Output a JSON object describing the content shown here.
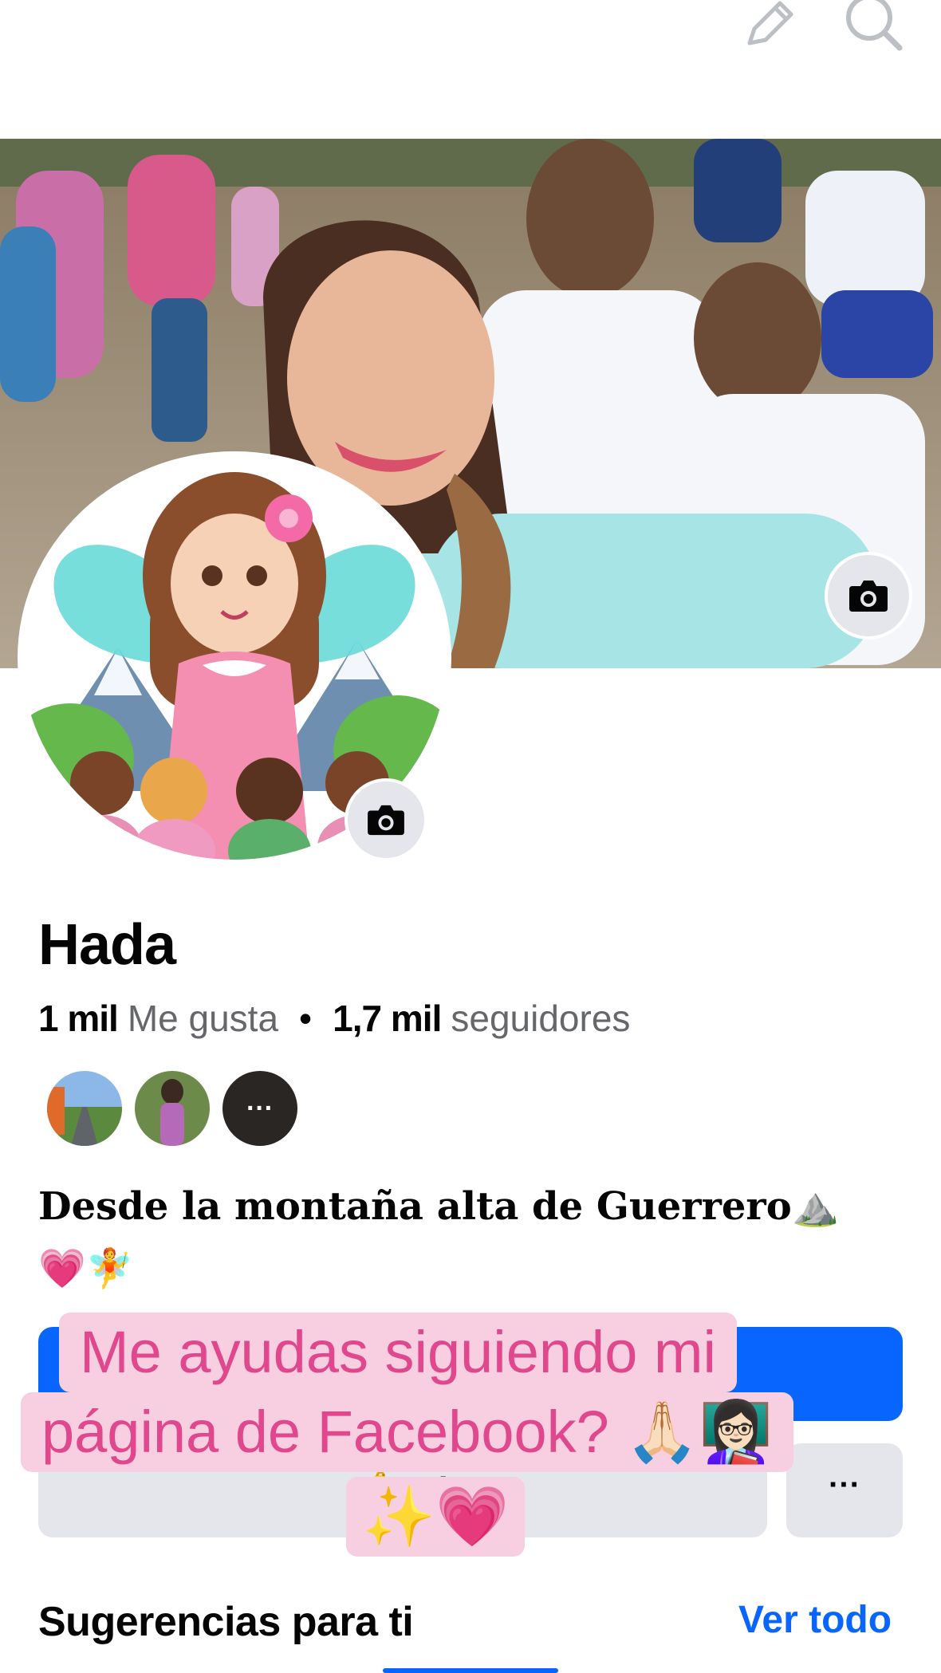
{
  "header": {
    "edit_icon": "pencil-icon",
    "search_icon": "search-icon"
  },
  "cover": {
    "camera_icon": "camera-icon"
  },
  "profile": {
    "name": "Hada",
    "likes_count": "1 mil",
    "likes_label": "Me gusta",
    "separator": "•",
    "followers_count": "1,7 mil",
    "followers_label": "seguidores",
    "friends_more": "···",
    "bio": "Desde la montaña alta de Guerrero⛰️💗🧚"
  },
  "actions": {
    "secondary_label": "🔔 Al",
    "more_label": "···"
  },
  "caption": {
    "line1": "Me ayudas siguiendo mi",
    "line2": "página de Facebook? 🙏🏻👩🏻‍🏫",
    "line3": "✨💗"
  },
  "suggestions": {
    "title": "Sugerencias para ti",
    "see_all": "Ver todo"
  },
  "colors": {
    "accent": "#0866ff",
    "caption_bg": "#f8cfe0",
    "caption_text": "#e0478c",
    "muted": "#65676b"
  }
}
